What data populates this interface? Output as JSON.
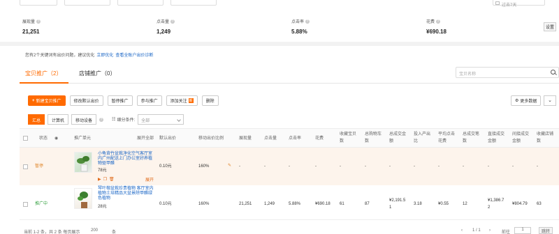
{
  "header": {
    "date_range": "过去7天"
  },
  "stats": [
    {
      "label": "展现量",
      "value": "21,251"
    },
    {
      "label": "点击量",
      "value": "1,249"
    },
    {
      "label": "点击率",
      "value": "5.88%"
    },
    {
      "label": "花费",
      "value": "¥690.18"
    }
  ],
  "settings_label": "设置",
  "notice": {
    "text": "您有2个关键词有出价问题，建议优化",
    "link1": "立即优化",
    "link2": "查看全账户出价诊断"
  },
  "tabs": [
    {
      "label": "宝贝推广（2）"
    },
    {
      "label": "店铺推广（0）"
    }
  ],
  "search": {
    "placeholder": "宝贝名称"
  },
  "actions": {
    "new_promo": "新建宝贝推广",
    "modify_bid": "修改默认出价",
    "pause": "暂停推广",
    "join": "参与推广",
    "add_follow": "添加关注",
    "add_follow_badge": "新",
    "delete": "删除",
    "more_data": "更多数据",
    "collapse": "⌄"
  },
  "filters": {
    "segments": [
      "汇总",
      "计算机",
      "移动设备"
    ],
    "dim_label": "细分条件:",
    "select_value": "全部"
  },
  "table": {
    "headers": {
      "status": "状态",
      "unit": "推广单元",
      "expand_all": "展开全部",
      "default_bid": "默认出价",
      "mobile_ratio": "移动出价比例",
      "impressions": "展现量",
      "clicks": "点击量",
      "ctr": "点击率",
      "cost": "花费",
      "fav_item_1": "收藏宝贝",
      "fav_item_2": "数",
      "cart_1": "总购物车",
      "cart_2": "数",
      "total_gmv_1": "总成交金",
      "total_gmv_2": "额",
      "roi_1": "投入产出",
      "roi_2": "比",
      "avg_cpc_1": "平均点击",
      "avg_cpc_2": "花费",
      "total_orders_1": "总成交笔",
      "total_orders_2": "数",
      "direct_gmv_1": "直接成交",
      "direct_gmv_2": "金额",
      "indirect_gmv_1": "间接成交",
      "indirect_gmv_2": "金额",
      "fav_shop_1": "收藏店铺",
      "fav_shop_2": "数"
    },
    "rows": [
      {
        "status": "暂停",
        "name": "小龟背竹盆栽净化空气客厅室内广州配送上门办公室好养植物驱甲醛",
        "price": "78元",
        "expand": "展开",
        "default_bid": "0.10元",
        "mobile_ratio": "160%",
        "impressions": "-",
        "clicks": "-",
        "ctr": "-",
        "cost": "-",
        "fav_item": "-",
        "cart": "-",
        "total_gmv": "-",
        "roi": "-",
        "avg_cpc": "-",
        "total_orders": "-",
        "direct_gmv": "-",
        "indirect_gmv": "-",
        "fav_shop": "-"
      },
      {
        "status": "推广中",
        "name": "琴叶榕盆栽珍贵植物 客厅室内植物土培精品大盆景除甲醛绿色植物",
        "price": "28元",
        "default_bid": "0.10元",
        "mobile_ratio": "160%",
        "impressions": "21,251",
        "clicks": "1,249",
        "ctr": "5.88%",
        "cost": "¥690.18",
        "fav_item": "61",
        "cart": "87",
        "total_gmv_1": "¥2,191.5",
        "total_gmv_2": "1",
        "roi": "3.18",
        "avg_cpc": "¥0.55",
        "total_orders": "12",
        "direct_gmv_1": "¥1,386.7",
        "direct_gmv_2": "2",
        "indirect_gmv": "¥804.79",
        "fav_shop": "63"
      }
    ]
  },
  "footer": {
    "summary": "当前 1-2 条，共 2 条 每页展示",
    "page_size": "200",
    "unit": "条",
    "page_info": "1 / 1",
    "goto": "前往",
    "page_value": "1",
    "jump": "跳转"
  }
}
